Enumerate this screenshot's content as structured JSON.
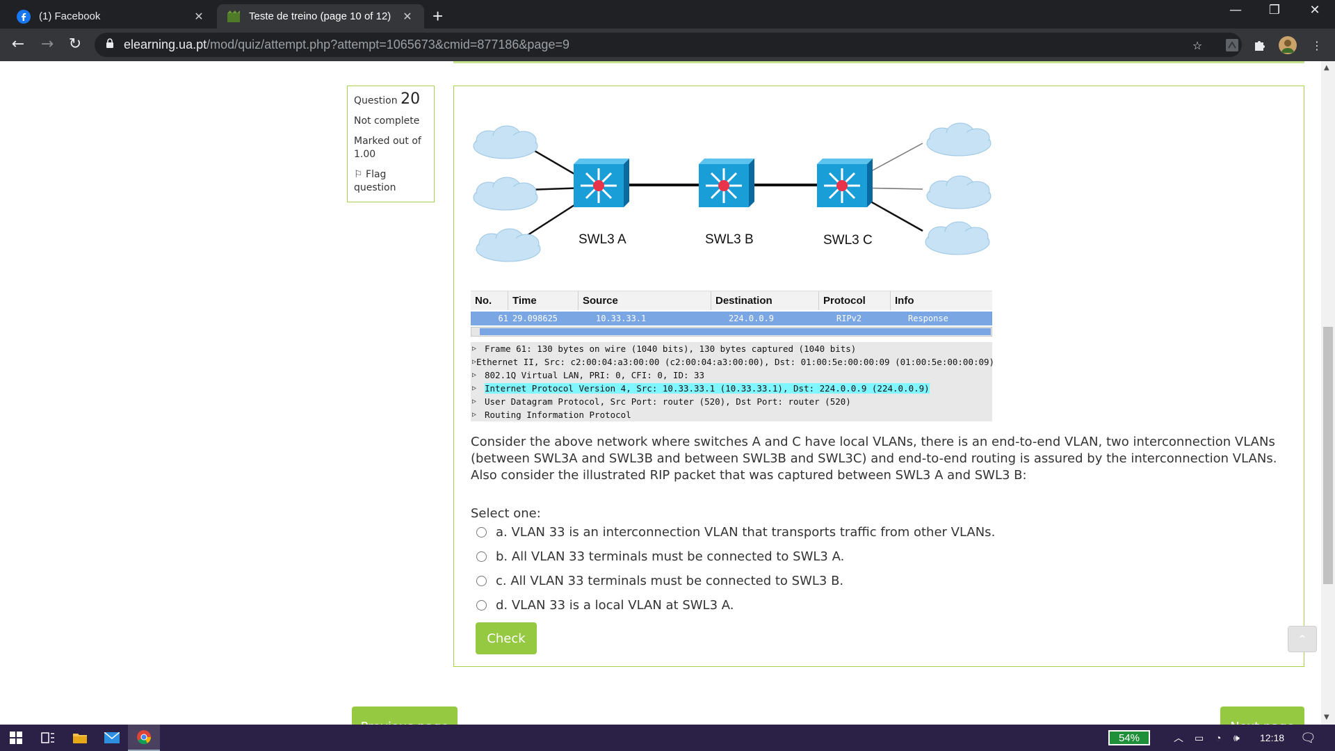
{
  "browser": {
    "tabs": [
      {
        "label": "(1) Facebook",
        "icon": "facebook-icon"
      },
      {
        "label": "Teste de treino (page 10 of 12)",
        "icon": "moodle-icon"
      }
    ],
    "new_tab": "+",
    "url_host": "elearning.ua.pt",
    "url_path": "/mod/quiz/attempt.php?attempt=1065673&cmid=877186&page=9"
  },
  "question_info": {
    "question_word": "Question",
    "number": "20",
    "status": "Not complete",
    "marked_out_of": "Marked out of 1.00",
    "flag_label": "Flag question"
  },
  "diagram": {
    "switches": [
      "SWL3 A",
      "SWL3 B",
      "SWL3 C"
    ]
  },
  "capture": {
    "columns": [
      "No.",
      "Time",
      "Source",
      "Destination",
      "Protocol",
      "Info"
    ],
    "row": {
      "no": "61",
      "time": "29.098625",
      "source": "10.33.33.1",
      "destination": "224.0.0.9",
      "protocol": "RIPv2",
      "info": "Response"
    },
    "details": [
      "Frame 61: 130 bytes on wire (1040 bits), 130 bytes captured (1040 bits)",
      "Ethernet II, Src: c2:00:04:a3:00:00 (c2:00:04:a3:00:00), Dst: 01:00:5e:00:00:09 (01:00:5e:00:00:09)",
      "802.1Q Virtual LAN, PRI: 0, CFI: 0, ID: 33",
      "Internet Protocol Version 4, Src: 10.33.33.1 (10.33.33.1), Dst: 224.0.0.9 (224.0.0.9)",
      "User Datagram Protocol, Src Port: router (520), Dst Port: router (520)",
      "Routing Information Protocol"
    ]
  },
  "question": {
    "text": "Consider the above network where switches A and C have local VLANs, there is an end-to-end VLAN, two interconnection VLANs (between SWL3A and SWL3B and between SWL3B and SWL3C) and end-to-end routing is assured by the interconnection VLANs. Also consider the illustrated RIP packet that was captured between SWL3 A and SWL3 B:",
    "select_one": "Select one:",
    "options": [
      "a. VLAN 33 is an interconnection VLAN that transports traffic from other VLANs.",
      "b. All VLAN 33 terminals must be connected to SWL3 A.",
      "c. All VLAN 33 terminals must be connected to SWL3 B.",
      "d. VLAN 33 is a local VLAN at SWL3 A."
    ],
    "check_label": "Check"
  },
  "navigation": {
    "previous": "Previous page",
    "next": "Next page"
  },
  "taskbar": {
    "battery": "54%",
    "time": "12:18"
  },
  "colors": {
    "accent_green": "#95c941",
    "border_green": "#a7d155",
    "switch_blue": "#1a9ed8"
  }
}
